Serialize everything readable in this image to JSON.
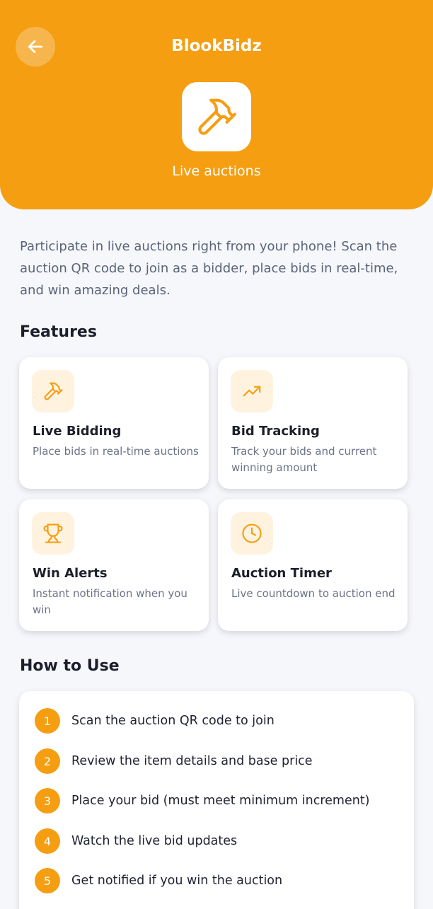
{
  "header": {
    "title": "BlookBidz",
    "subtitle": "Live auctions",
    "back_icon": "arrow-left-icon",
    "hero_icon": "hammer-icon",
    "accent_color": "#f59e12"
  },
  "intro": "Participate in live auctions right from your phone! Scan the auction QR code to join as a bidder, place bids in real-time, and win amazing deals.",
  "features": {
    "title": "Features",
    "items": [
      {
        "title": "Live Bidding",
        "description": "Place bids in real-time auctions",
        "icon": "hammer-icon"
      },
      {
        "title": "Bid Tracking",
        "description": "Track your bids and current winning amount",
        "icon": "trending-up-icon"
      },
      {
        "title": "Win Alerts",
        "description": "Instant notification when you win",
        "icon": "trophy-icon"
      },
      {
        "title": "Auction Timer",
        "description": "Live countdown to auction end",
        "icon": "clock-icon"
      }
    ]
  },
  "how_to_use": {
    "title": "How to Use",
    "steps": [
      {
        "number": "1",
        "text": "Scan the auction QR code to join"
      },
      {
        "number": "2",
        "text": "Review the item details and base price"
      },
      {
        "number": "3",
        "text": "Place your bid (must meet minimum increment)"
      },
      {
        "number": "4",
        "text": "Watch the live bid updates"
      },
      {
        "number": "5",
        "text": "Get notified if you win the auction"
      }
    ]
  }
}
